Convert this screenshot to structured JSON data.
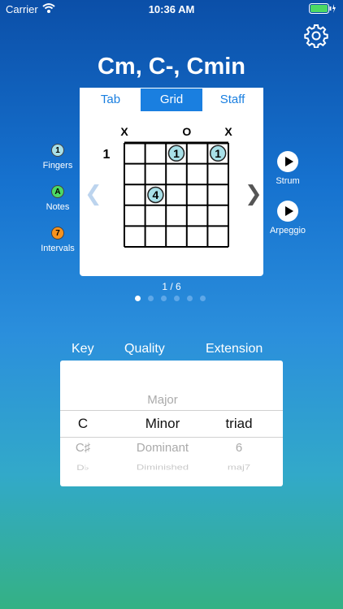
{
  "status": {
    "carrier": "Carrier",
    "time": "10:36 AM"
  },
  "chord_name": "Cm, C-, Cmin",
  "tabs": [
    "Tab",
    "Grid",
    "Staff"
  ],
  "diagram": {
    "string_markers": [
      "X",
      "",
      "",
      "O",
      "",
      "X"
    ],
    "base_fret": "1",
    "dots": [
      {
        "string": 3,
        "fret": 1,
        "label": "1"
      },
      {
        "string": 5,
        "fret": 1,
        "label": "1"
      },
      {
        "string": 2,
        "fret": 3,
        "label": "4"
      }
    ]
  },
  "legend": {
    "fingers": {
      "badge": "1",
      "label": "Fingers",
      "color": "#a8e0e8"
    },
    "notes": {
      "badge": "A",
      "label": "Notes",
      "color": "#4cd964"
    },
    "intervals": {
      "badge": "7",
      "label": "Intervals",
      "color": "#f7931e"
    }
  },
  "actions": {
    "strum": "Strum",
    "arpeggio": "Arpeggio"
  },
  "nav": {
    "prev": "❮",
    "next": "❯"
  },
  "pagination": {
    "label": "1 / 6",
    "total": 6,
    "current": 1
  },
  "picker": {
    "headers": {
      "key": "Key",
      "quality": "Quality",
      "extension": "Extension"
    },
    "quality_above": "Major",
    "selected": {
      "key": "C",
      "quality": "Minor",
      "extension": "triad"
    },
    "below": {
      "key": "C♯",
      "quality": "Dominant",
      "extension": "6"
    },
    "below2": {
      "key": "D♭",
      "quality": "Diminished",
      "extension": "maj7"
    }
  },
  "colors": {
    "accent": "#1a7fe0",
    "dot_fill": "#a8e0e8"
  }
}
